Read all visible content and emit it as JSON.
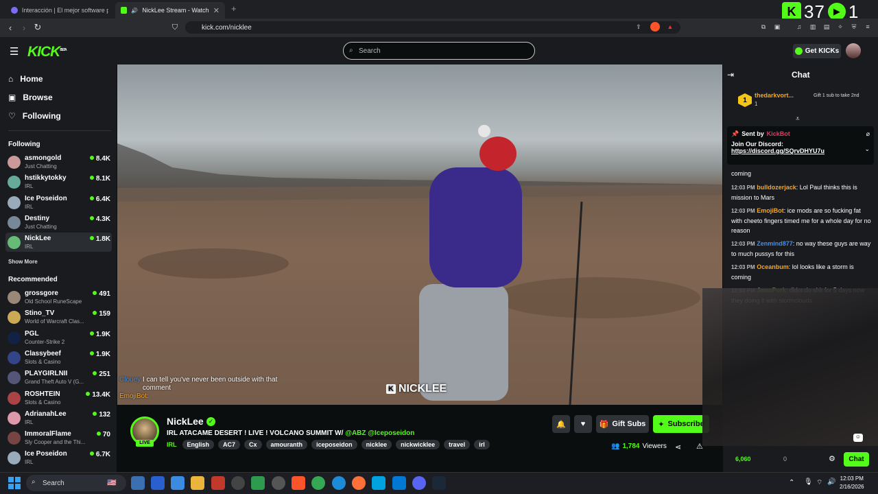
{
  "browser": {
    "tabs": [
      {
        "label": "Interacción | El mejor software para...",
        "active": false
      },
      {
        "label": "NickLee Stream - Watch Live...",
        "active": true
      }
    ],
    "url": "kick.com/nicklee"
  },
  "overlay": {
    "left_num": "37",
    "right_num": "1"
  },
  "header": {
    "logo": "KICK",
    "logo_tag": "BETA",
    "search_placeholder": "Search",
    "get_kicks": "Get KICKs"
  },
  "sidebar": {
    "nav": [
      {
        "label": "Home",
        "icon": "home-icon"
      },
      {
        "label": "Browse",
        "icon": "browse-icon"
      },
      {
        "label": "Following",
        "icon": "heart-icon"
      }
    ],
    "following_title": "Following",
    "following": [
      {
        "name": "asmongold",
        "category": "Just Chatting",
        "viewers": "8.4K",
        "color": "#c99"
      },
      {
        "name": "hstikkytokky",
        "category": "IRL",
        "viewers": "8.1K",
        "color": "#6a9"
      },
      {
        "name": "Ice Poseidon",
        "category": "IRL",
        "viewers": "6.4K",
        "color": "#9ab"
      },
      {
        "name": "Destiny",
        "category": "Just Chatting",
        "viewers": "4.3K",
        "color": "#789"
      },
      {
        "name": "NickLee",
        "category": "IRL",
        "viewers": "1.8K",
        "color": "#6b7",
        "selected": true
      }
    ],
    "show_more": "Show More",
    "recommended_title": "Recommended",
    "recommended": [
      {
        "name": "grossgore",
        "category": "Old School RuneScape",
        "viewers": "491",
        "color": "#987"
      },
      {
        "name": "Stino_TV",
        "category": "World of Warcraft Clas...",
        "viewers": "159",
        "color": "#ca5"
      },
      {
        "name": "PGL",
        "category": "Counter-Strike 2",
        "viewers": "1.9K",
        "color": "#124"
      },
      {
        "name": "Classybeef",
        "category": "Slots & Casino",
        "viewers": "1.9K",
        "color": "#348"
      },
      {
        "name": "PLAYGIRLNII",
        "category": "Grand Theft Auto V (G...",
        "viewers": "251",
        "color": "#557"
      },
      {
        "name": "ROSHTEIN",
        "category": "Slots & Casino",
        "viewers": "13.4K",
        "color": "#a44"
      },
      {
        "name": "AdrianahLee",
        "category": "IRL",
        "viewers": "132",
        "color": "#d9a"
      },
      {
        "name": "ImmoralFlame",
        "category": "Sly Cooper and the Thi...",
        "viewers": "70",
        "color": "#744"
      },
      {
        "name": "Ice Poseidon",
        "category": "IRL",
        "viewers": "6.7K",
        "color": "#9ab"
      }
    ]
  },
  "video": {
    "overlay_chat_user": "Clouey",
    "overlay_chat_text": "I can tell you've never been outside with that comment",
    "overlay_chat_user2": "EmojiBot:",
    "watermark": "NICKLEE"
  },
  "stream": {
    "name": "NickLee",
    "live": "LIVE",
    "title": "IRL ATACAME DESERT ! LIVE ! VOLCANO SUMMIT W/",
    "title_mentions": "@ABZ @Iceposeidon",
    "category": "IRL",
    "tags": [
      "English",
      "AC7",
      "Cx",
      "amouranth",
      "iceposeidon",
      "nicklee",
      "nickwicklee",
      "travel",
      "irl"
    ],
    "gift_subs": "Gift Subs",
    "subscribe": "Subscribe",
    "viewers_count": "1,784",
    "viewers_label": "Viewers"
  },
  "chat": {
    "title": "Chat",
    "leader_name": "thedarkvort...",
    "leader_count": "1",
    "leader_rank": "1",
    "gift_cta": "Gift 1 sub to take 2nd",
    "pinned_by_label": "Sent by",
    "pinned_by_user": "KickBot",
    "pinned_text": "Join Our Discord:",
    "pinned_link": "https://discord.gg/SQrvDHYU7u",
    "partial_line": "coming",
    "messages": [
      {
        "time": "12:03 PM",
        "user": "bulldozerjack",
        "color": "#f5a623",
        "text": "Lol Paul thinks this is mission to Mars"
      },
      {
        "time": "12:03 PM",
        "user": "EmojiBot",
        "color": "#f5a623",
        "text": "ice mods are so fucking fat with cheeto fingers timed me for a whole day for no reason"
      },
      {
        "time": "12:03 PM",
        "user": "Zenmind877",
        "color": "#4a90e2",
        "text": "no way these guys are way to much pussys for this"
      },
      {
        "time": "12:03 PM",
        "user": "Oceanbum",
        "color": "#f5a623",
        "text": "lol looks like a storm is coming"
      },
      {
        "time": "12:03 PM",
        "user": "JawnPork",
        "color": "#53fc18",
        "text": "didnt do shit for 5 days now they doing it with stormclouds"
      }
    ],
    "points": "6,060",
    "points_other": "0",
    "chat_button": "Chat"
  },
  "taskbar": {
    "search": "Search",
    "time": "12:03 PM",
    "date": "2/16/2026"
  }
}
